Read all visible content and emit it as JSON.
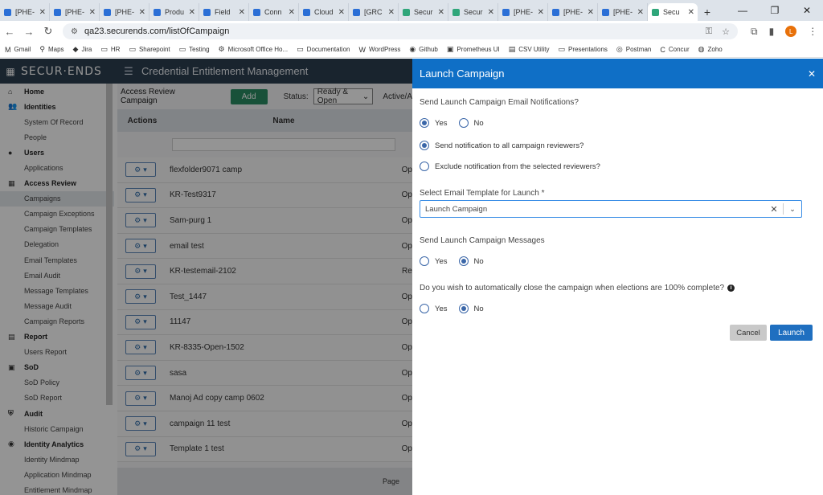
{
  "browser": {
    "tabs": [
      {
        "label": "[PHE-",
        "icon": "app-icon"
      },
      {
        "label": "[PHE-",
        "icon": "app-icon"
      },
      {
        "label": "[PHE-",
        "icon": "app-icon"
      },
      {
        "label": "Produ",
        "icon": "app-icon"
      },
      {
        "label": "Field",
        "icon": "app-icon"
      },
      {
        "label": "Conn",
        "icon": "app-icon"
      },
      {
        "label": "Cloud",
        "icon": "app-icon"
      },
      {
        "label": "[GRC",
        "icon": "app-icon"
      },
      {
        "label": "Secur",
        "icon": "securends-icon"
      },
      {
        "label": "Secur",
        "icon": "securends-icon"
      },
      {
        "label": "[PHE-",
        "icon": "app-icon"
      },
      {
        "label": "[PHE-",
        "icon": "app-icon"
      },
      {
        "label": "[PHE-",
        "icon": "app-icon"
      },
      {
        "label": "Secu",
        "icon": "securends-icon"
      }
    ],
    "url": "qa23.securends.com/listOfCampaign",
    "profile_initial": "L",
    "bookmarks": [
      "Gmail",
      "Maps",
      "Jira",
      "HR",
      "Sharepoint",
      "Testing",
      "Microsoft Office Ho...",
      "Documentation",
      "WordPress",
      "Github",
      "Prometheus UI",
      "CSV Utility",
      "Presentations",
      "Postman",
      "Concur",
      "Zoho"
    ]
  },
  "app": {
    "logo": "SECUR·ENDS",
    "title": "Credential Entitlement Management"
  },
  "sidebar": {
    "items": [
      {
        "label": "Home",
        "type": "section",
        "icon": "home-icon"
      },
      {
        "label": "Identities",
        "type": "section",
        "icon": "users-icon"
      },
      {
        "label": "System Of Record",
        "type": "sub"
      },
      {
        "label": "People",
        "type": "sub"
      },
      {
        "label": "Users",
        "type": "section",
        "icon": "user-icon"
      },
      {
        "label": "Applications",
        "type": "sub"
      },
      {
        "label": "Access Review",
        "type": "section",
        "icon": "grid-icon"
      },
      {
        "label": "Campaigns",
        "type": "sub",
        "active": true
      },
      {
        "label": "Campaign Exceptions",
        "type": "sub"
      },
      {
        "label": "Campaign Templates",
        "type": "sub"
      },
      {
        "label": "Delegation",
        "type": "sub"
      },
      {
        "label": "Email Templates",
        "type": "sub"
      },
      {
        "label": "Email Audit",
        "type": "sub"
      },
      {
        "label": "Message Templates",
        "type": "sub"
      },
      {
        "label": "Message Audit",
        "type": "sub"
      },
      {
        "label": "Campaign Reports",
        "type": "sub"
      },
      {
        "label": "Report",
        "type": "section",
        "icon": "report-icon"
      },
      {
        "label": "Users Report",
        "type": "sub"
      },
      {
        "label": "SoD",
        "type": "section",
        "icon": "sod-icon"
      },
      {
        "label": "SoD Policy",
        "type": "sub"
      },
      {
        "label": "SoD Report",
        "type": "sub"
      },
      {
        "label": "Audit",
        "type": "section",
        "icon": "shield-icon"
      },
      {
        "label": "Historic Campaign",
        "type": "sub"
      },
      {
        "label": "Identity Analytics",
        "type": "section",
        "icon": "analytics-icon"
      },
      {
        "label": "Identity Mindmap",
        "type": "sub"
      },
      {
        "label": "Application Mindmap",
        "type": "sub"
      },
      {
        "label": "Entitlement Mindmap",
        "type": "sub"
      }
    ]
  },
  "main": {
    "breadcrumb": "Access Review Campaign",
    "add_label": "Add",
    "status_label": "Status:",
    "status_value": "Ready & Open",
    "active_label": "Active/A",
    "columns": [
      "Actions",
      "Name"
    ],
    "rows": [
      {
        "name": "flexfolder9071 camp",
        "status": "Op"
      },
      {
        "name": "KR-Test9317",
        "status": "Op"
      },
      {
        "name": "Sam-purg 1",
        "status": "Op"
      },
      {
        "name": "email test",
        "status": "Op"
      },
      {
        "name": "KR-testemail-2102",
        "status": "Re"
      },
      {
        "name": "Test_1447",
        "status": "Op"
      },
      {
        "name": "11147",
        "status": "Op"
      },
      {
        "name": "KR-8335-Open-1502",
        "status": "Op"
      },
      {
        "name": "sasa",
        "status": "Op"
      },
      {
        "name": "Manoj Ad copy camp 0602",
        "status": "Op"
      },
      {
        "name": "campaign 11 test",
        "status": "Op"
      },
      {
        "name": "Template 1 test",
        "status": "Op"
      }
    ],
    "pager_label": "Page"
  },
  "panel": {
    "title": "Launch Campaign",
    "q1": "Send Launch Campaign Email Notifications?",
    "q1_yes": "Yes",
    "q1_no": "No",
    "notify_all": "Send notification to all campaign reviewers?",
    "notify_exclude": "Exclude notification from the selected reviewers?",
    "template_label": "Select Email Template for Launch *",
    "template_value": "Launch Campaign",
    "q2": "Send Launch Campaign Messages",
    "q2_yes": "Yes",
    "q2_no": "No",
    "q3": "Do you wish to automatically close the campaign when elections are 100% complete?",
    "q3_yes": "Yes",
    "q3_no": "No",
    "cancel_label": "Cancel",
    "launch_label": "Launch"
  },
  "colors": {
    "header_bg": "#2c3e50",
    "panel_header": "#0f6fc6",
    "add_button": "#2a8c63",
    "launch_button": "#1f6fc0"
  }
}
